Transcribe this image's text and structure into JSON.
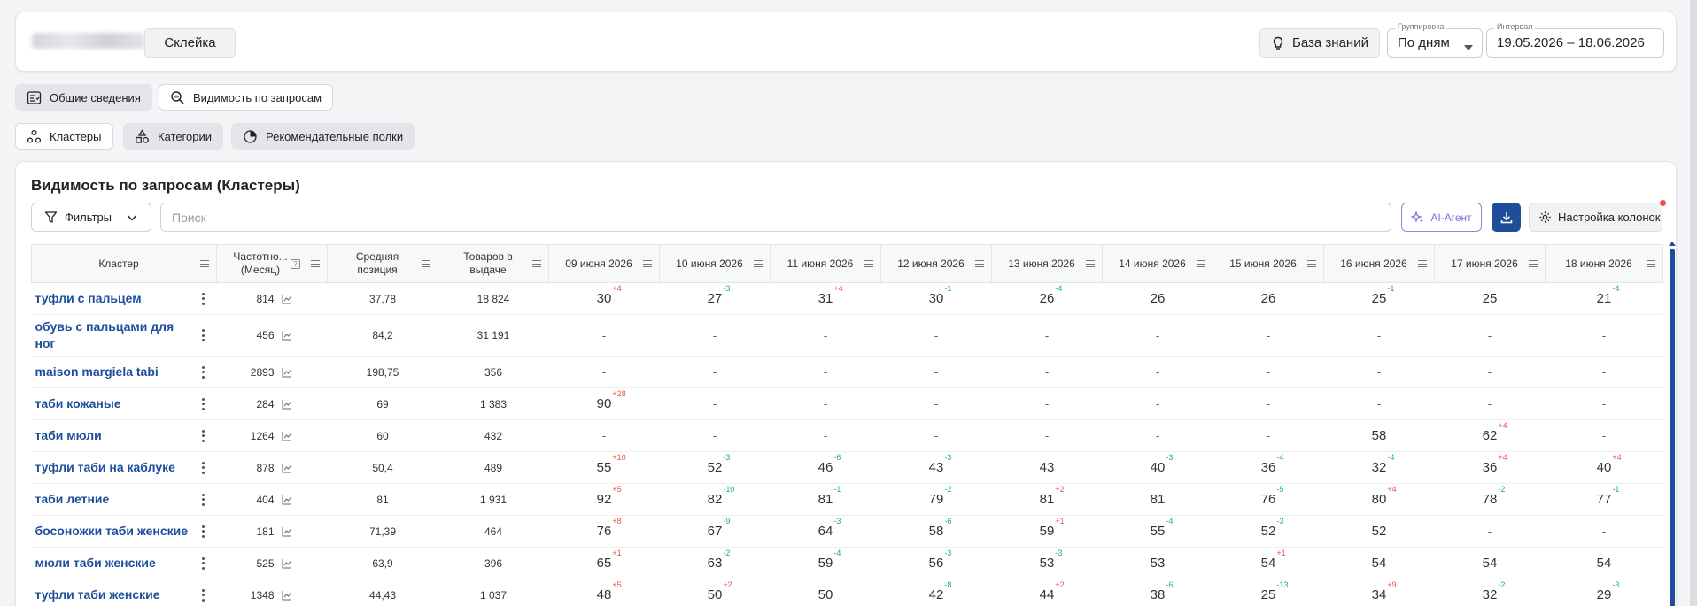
{
  "header": {
    "product_name_redacted": "",
    "merge_button": "Склейка",
    "kb_button": "База знаний",
    "grouping": {
      "label": "Группировка",
      "value": "По дням"
    },
    "interval": {
      "label": "Интервал",
      "value": "19.05.2026 – 18.06.2026"
    }
  },
  "tabs_top": [
    {
      "label": "Общие сведения",
      "icon": "checklist-icon",
      "active": true
    },
    {
      "label": "Видимость по запросам",
      "icon": "search-chart-icon",
      "active": false
    }
  ],
  "tabs_sub": [
    {
      "label": "Кластеры",
      "icon": "cluster-icon",
      "active": false
    },
    {
      "label": "Категории",
      "icon": "shapes-icon",
      "active": true
    },
    {
      "label": "Рекомендательные полки",
      "icon": "pie-icon",
      "active": true
    }
  ],
  "card": {
    "title": "Видимость по запросам (Кластеры)",
    "filters_label": "Фильтры",
    "search_placeholder": "Поиск",
    "ai_label": "AI-Агент",
    "columns_settings_label": "Настройка колонок"
  },
  "table": {
    "columns": [
      "Кластер",
      "Частотно... (Месяц)",
      "Средняя позиция",
      "Товаров в выдаче",
      "09 июня 2026",
      "10 июня 2026",
      "11 июня 2026",
      "12 июня 2026",
      "13 июня 2026",
      "14 июня 2026",
      "15 июня 2026",
      "16 июня 2026",
      "17 июня 2026",
      "18 июня 2026"
    ],
    "rows": [
      {
        "cluster": "туфли с пальцем",
        "freq": "814",
        "avg": "37,78",
        "goods": "18 824",
        "days": [
          [
            "30",
            "+4"
          ],
          [
            "27",
            "-3"
          ],
          [
            "31",
            "+4"
          ],
          [
            "30",
            "-1"
          ],
          [
            "26",
            "-4"
          ],
          [
            "26",
            ""
          ],
          [
            "26",
            ""
          ],
          [
            "25",
            "-1"
          ],
          [
            "25",
            ""
          ],
          [
            "21",
            "-4"
          ]
        ]
      },
      {
        "cluster": "обувь с пальцами для ног",
        "freq": "456",
        "avg": "84,2",
        "goods": "31 191",
        "days": [
          [
            "-",
            ""
          ],
          [
            "-",
            ""
          ],
          [
            "-",
            ""
          ],
          [
            "-",
            ""
          ],
          [
            "-",
            ""
          ],
          [
            "-",
            ""
          ],
          [
            "-",
            ""
          ],
          [
            "-",
            ""
          ],
          [
            "-",
            ""
          ],
          [
            "-",
            ""
          ]
        ]
      },
      {
        "cluster": "maison margiela tabi",
        "freq": "2893",
        "avg": "198,75",
        "goods": "356",
        "days": [
          [
            "-",
            ""
          ],
          [
            "-",
            ""
          ],
          [
            "-",
            ""
          ],
          [
            "-",
            ""
          ],
          [
            "-",
            ""
          ],
          [
            "-",
            ""
          ],
          [
            "-",
            ""
          ],
          [
            "-",
            ""
          ],
          [
            "-",
            ""
          ],
          [
            "-",
            ""
          ]
        ]
      },
      {
        "cluster": "таби кожаные",
        "freq": "284",
        "avg": "69",
        "goods": "1 383",
        "days": [
          [
            "90",
            "+28"
          ],
          [
            "-",
            ""
          ],
          [
            "-",
            ""
          ],
          [
            "-",
            ""
          ],
          [
            "-",
            ""
          ],
          [
            "-",
            ""
          ],
          [
            "-",
            ""
          ],
          [
            "-",
            ""
          ],
          [
            "-",
            ""
          ],
          [
            "-",
            ""
          ]
        ]
      },
      {
        "cluster": "таби мюли",
        "freq": "1264",
        "avg": "60",
        "goods": "432",
        "days": [
          [
            "-",
            ""
          ],
          [
            "-",
            ""
          ],
          [
            "-",
            ""
          ],
          [
            "-",
            ""
          ],
          [
            "-",
            ""
          ],
          [
            "-",
            ""
          ],
          [
            "-",
            ""
          ],
          [
            "58",
            ""
          ],
          [
            "62",
            "+4"
          ],
          [
            "-",
            ""
          ]
        ]
      },
      {
        "cluster": "туфли таби на каблуке",
        "freq": "878",
        "avg": "50,4",
        "goods": "489",
        "days": [
          [
            "55",
            "+10"
          ],
          [
            "52",
            "-3"
          ],
          [
            "46",
            "-6"
          ],
          [
            "43",
            "-3"
          ],
          [
            "43",
            ""
          ],
          [
            "40",
            "-3"
          ],
          [
            "36",
            "-4"
          ],
          [
            "32",
            "-4"
          ],
          [
            "36",
            "+4"
          ],
          [
            "40",
            "+4"
          ]
        ]
      },
      {
        "cluster": "таби летние",
        "freq": "404",
        "avg": "81",
        "goods": "1 931",
        "days": [
          [
            "92",
            "+5"
          ],
          [
            "82",
            "-10"
          ],
          [
            "81",
            "-1"
          ],
          [
            "79",
            "-2"
          ],
          [
            "81",
            "+2"
          ],
          [
            "81",
            ""
          ],
          [
            "76",
            "-5"
          ],
          [
            "80",
            "+4"
          ],
          [
            "78",
            "-2"
          ],
          [
            "77",
            "-1"
          ]
        ]
      },
      {
        "cluster": "босоножки таби женские",
        "freq": "181",
        "avg": "71,39",
        "goods": "464",
        "days": [
          [
            "76",
            "+8"
          ],
          [
            "67",
            "-9"
          ],
          [
            "64",
            "-3"
          ],
          [
            "58",
            "-6"
          ],
          [
            "59",
            "+1"
          ],
          [
            "55",
            "-4"
          ],
          [
            "52",
            "-3"
          ],
          [
            "52",
            ""
          ],
          [
            "-",
            ""
          ],
          [
            "-",
            ""
          ]
        ]
      },
      {
        "cluster": "мюли таби женские",
        "freq": "525",
        "avg": "63,9",
        "goods": "396",
        "days": [
          [
            "65",
            "+1"
          ],
          [
            "63",
            "-2"
          ],
          [
            "59",
            "-4"
          ],
          [
            "56",
            "-3"
          ],
          [
            "53",
            "-3"
          ],
          [
            "53",
            ""
          ],
          [
            "54",
            "+1"
          ],
          [
            "54",
            ""
          ],
          [
            "54",
            ""
          ],
          [
            "54",
            ""
          ]
        ]
      },
      {
        "cluster": "туфли таби женские",
        "freq": "1348",
        "avg": "44,43",
        "goods": "1 037",
        "days": [
          [
            "48",
            "+5"
          ],
          [
            "50",
            "+2"
          ],
          [
            "50",
            ""
          ],
          [
            "42",
            "-8"
          ],
          [
            "44",
            "+2"
          ],
          [
            "38",
            "-6"
          ],
          [
            "25",
            "-13"
          ],
          [
            "34",
            "+9"
          ],
          [
            "32",
            "-2"
          ],
          [
            "29",
            "-3"
          ]
        ]
      }
    ]
  },
  "colors": {
    "accent": "#1f4d9a",
    "link": "#1c4e9c",
    "up": "#e5534b",
    "down": "#22a98a",
    "ai": "#8a6ad8"
  }
}
